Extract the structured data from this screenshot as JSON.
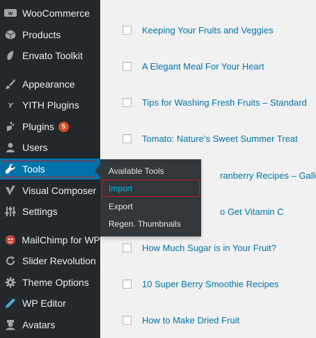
{
  "sidebar": {
    "items": [
      {
        "label": "WooCommerce",
        "icon": "woocommerce-icon",
        "badge": null
      },
      {
        "label": "Products",
        "icon": "products-icon",
        "badge": null
      },
      {
        "label": "Envato Toolkit",
        "icon": "envato-leaf-icon",
        "badge": null
      },
      {
        "label": "Appearance",
        "icon": "paintbrush-icon",
        "badge": null
      },
      {
        "label": "YITH Plugins",
        "icon": "yith-icon",
        "badge": null
      },
      {
        "label": "Plugins",
        "icon": "plugin-icon",
        "badge": "5"
      },
      {
        "label": "Users",
        "icon": "users-icon",
        "badge": null
      },
      {
        "label": "Tools",
        "icon": "wrench-icon",
        "badge": null
      },
      {
        "label": "Visual Composer",
        "icon": "visual-composer-icon",
        "badge": null
      },
      {
        "label": "Settings",
        "icon": "settings-icon",
        "badge": null
      },
      {
        "label": "MailChimp for WP",
        "icon": "mailchimp-icon",
        "badge": null
      },
      {
        "label": "Slider Revolution",
        "icon": "refresh-icon",
        "badge": null
      },
      {
        "label": "Theme Options",
        "icon": "gear-icon",
        "badge": null
      },
      {
        "label": "WP Editor",
        "icon": "pencil-icon",
        "badge": null
      },
      {
        "label": "Avatars",
        "icon": "avatar-icon",
        "badge": null
      }
    ]
  },
  "tools_submenu": {
    "items": [
      {
        "label": "Available Tools"
      },
      {
        "label": "Import"
      },
      {
        "label": "Export"
      },
      {
        "label": "Regen. Thumbnails"
      }
    ]
  },
  "posts": [
    {
      "title": "Keeping Your Fruits and Veggies"
    },
    {
      "title": "A Elegant Meal For Your Heart"
    },
    {
      "title": "Tips for Washing Fresh Fruits – Standard"
    },
    {
      "title": "Tomato: Nature’s Sweet Summer Treat"
    },
    {
      "title": "ranberry Recipes – Gallery"
    },
    {
      "title": "o Get Vitamin C"
    },
    {
      "title": "How Much Sugar is in Your Fruit?"
    },
    {
      "title": "10 Super Berry Smoothie Recipes"
    },
    {
      "title": "How to Make Dried Fruit"
    }
  ],
  "colors": {
    "sidebar_bg": "#23282d",
    "flyout_bg": "#32373c",
    "active_blue": "#0073aa",
    "submenu_active": "#00b9eb",
    "highlight_red": "#c9181e",
    "link_blue": "#0073aa"
  }
}
